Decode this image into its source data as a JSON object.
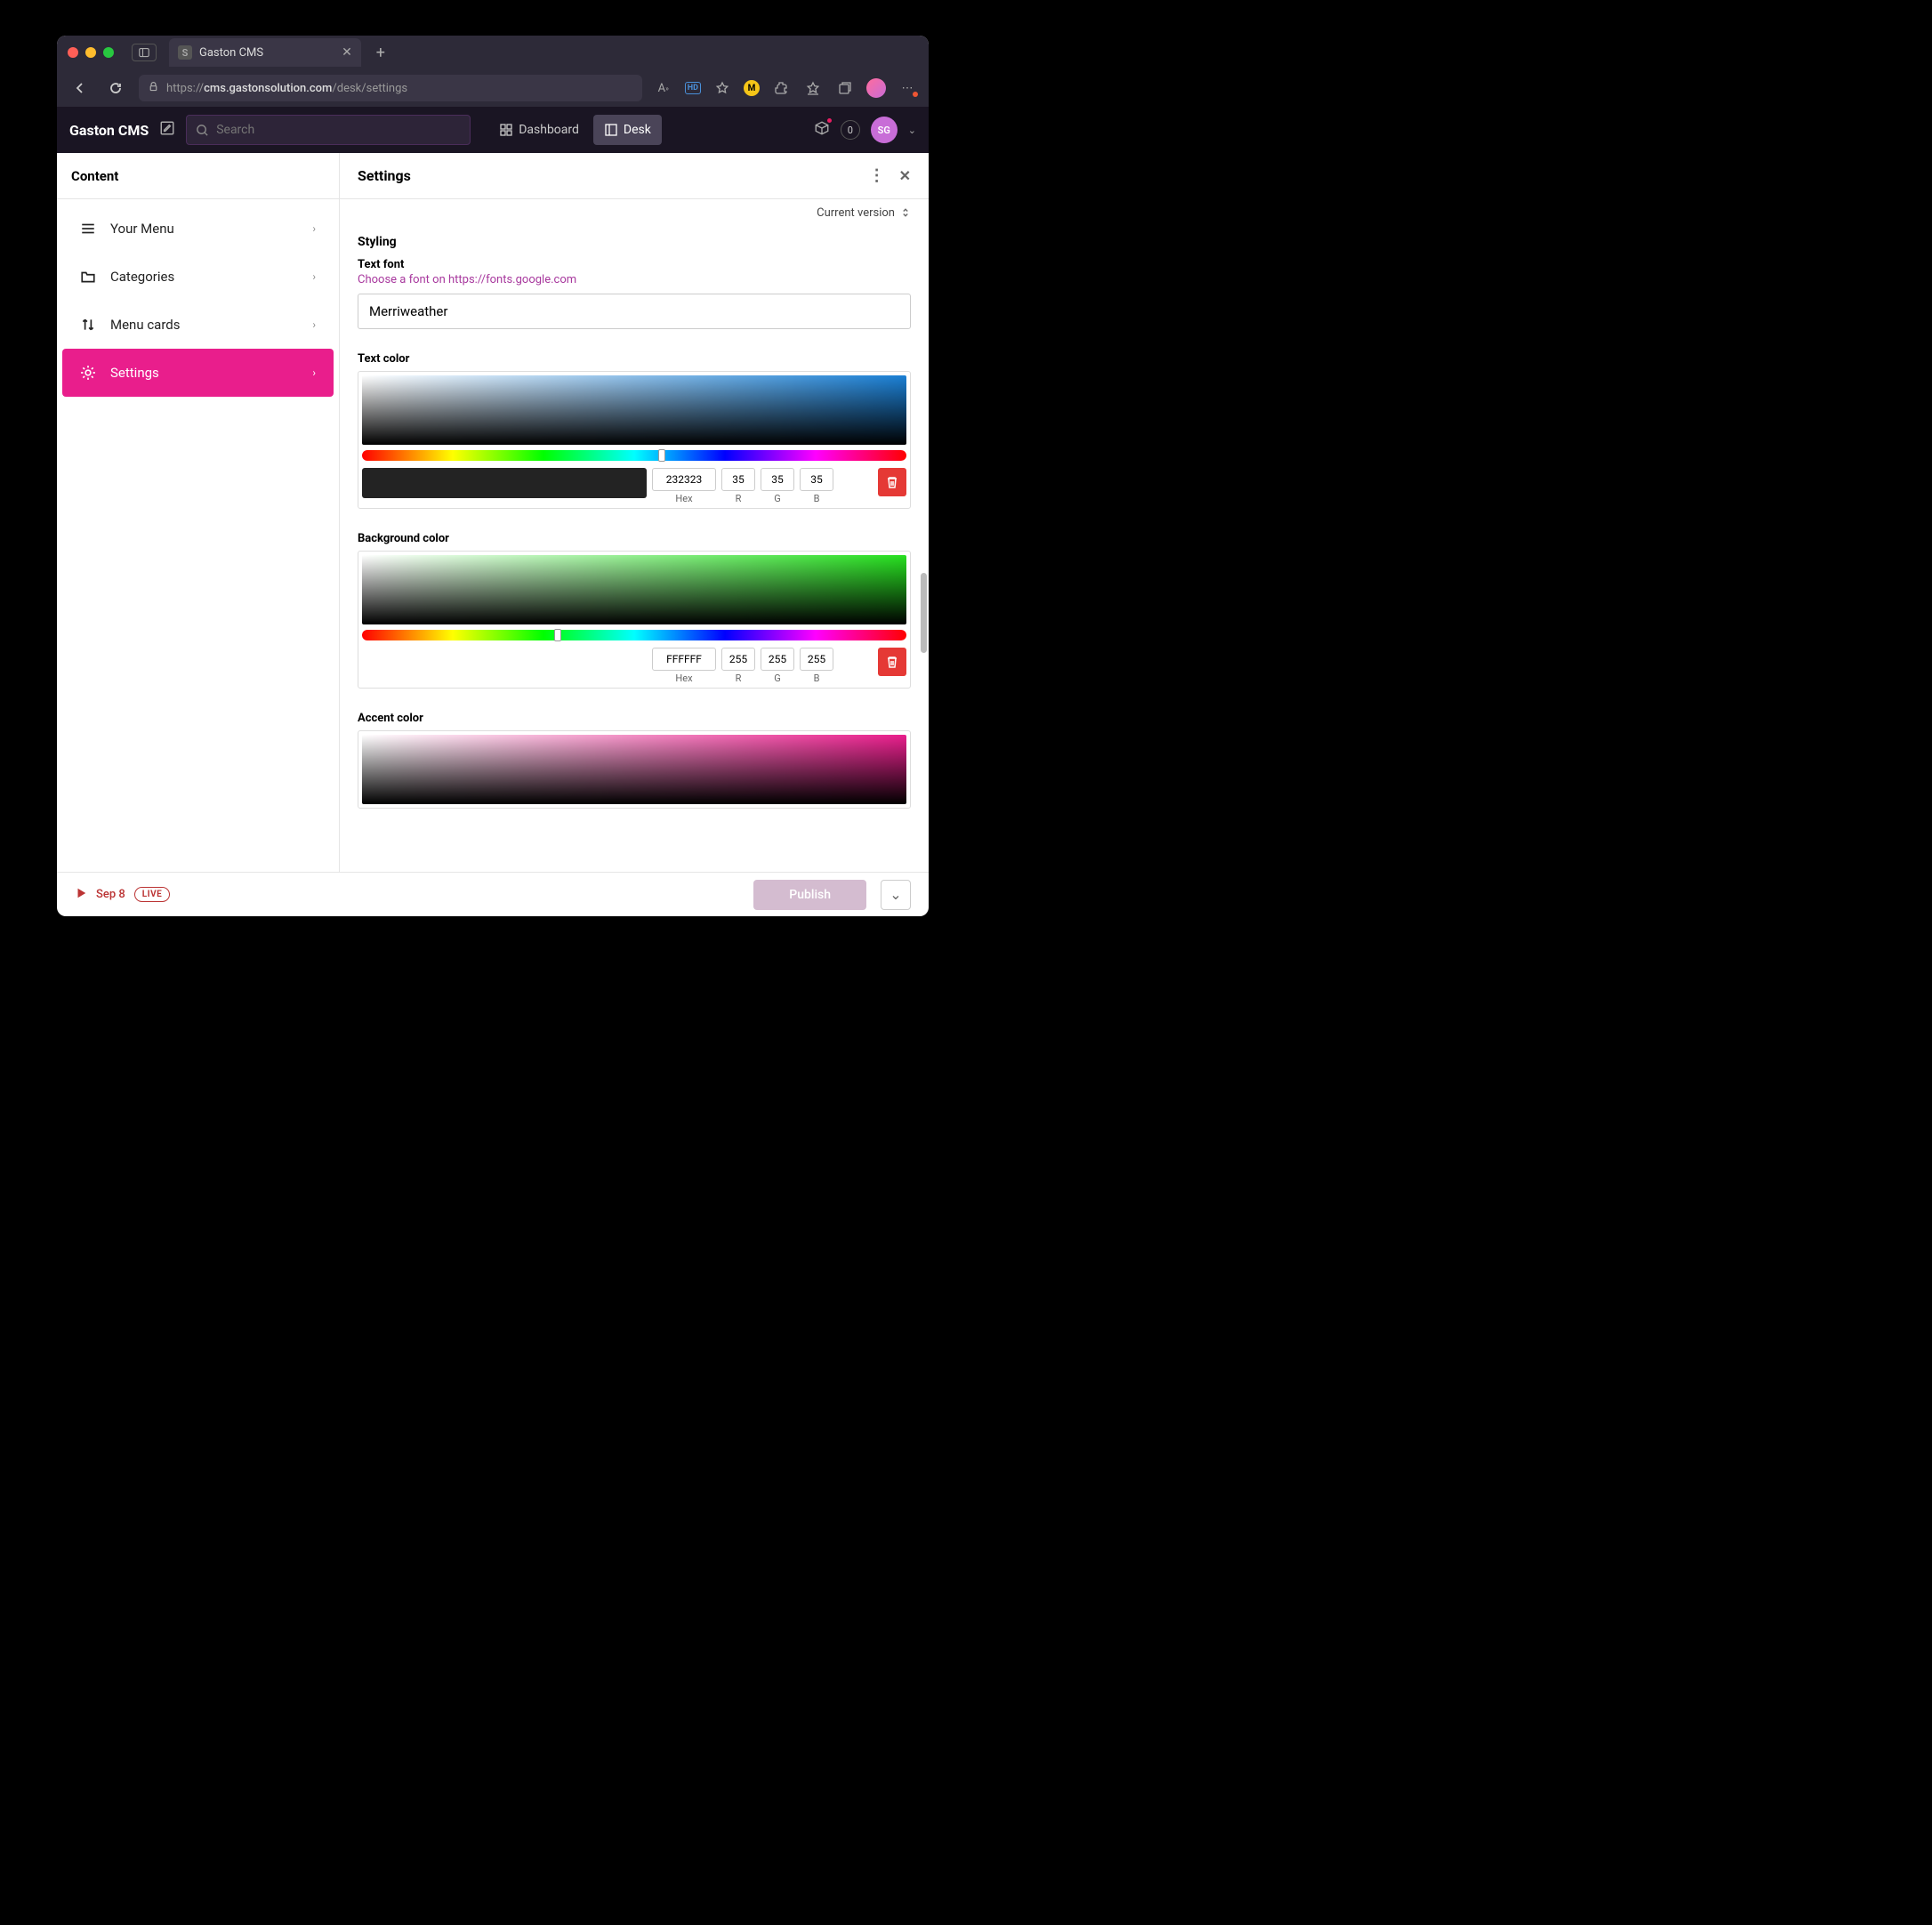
{
  "browser": {
    "tab_title": "Gaston CMS",
    "url_display": "cms.gastonsolution.com",
    "url_path": "/desk/settings",
    "url_prefix": "https://"
  },
  "appbar": {
    "brand": "Gaston CMS",
    "search_placeholder": "Search",
    "nav": {
      "dashboard": "Dashboard",
      "desk": "Desk"
    },
    "count": "0",
    "user_initials": "SG"
  },
  "sidebar": {
    "title": "Content",
    "items": [
      {
        "label": "Your Menu"
      },
      {
        "label": "Categories"
      },
      {
        "label": "Menu cards"
      },
      {
        "label": "Settings"
      }
    ]
  },
  "main": {
    "title": "Settings",
    "version_label": "Current version",
    "section": "Styling",
    "font": {
      "label": "Text font",
      "hint": "Choose a font on https://fonts.google.com",
      "value": "Merriweather"
    },
    "text_color": {
      "label": "Text color",
      "hex": "232323",
      "r": "35",
      "g": "35",
      "b": "35",
      "hue_pos": "55%",
      "swatch": "#232323"
    },
    "bg_color": {
      "label": "Background color",
      "hex": "FFFFFF",
      "r": "255",
      "g": "255",
      "b": "255",
      "hue_pos": "36%"
    },
    "accent_color": {
      "label": "Accent color"
    },
    "labels": {
      "hex": "Hex",
      "r": "R",
      "g": "G",
      "b": "B"
    }
  },
  "footer": {
    "date": "Sep 8",
    "live": "LIVE",
    "publish": "Publish"
  }
}
